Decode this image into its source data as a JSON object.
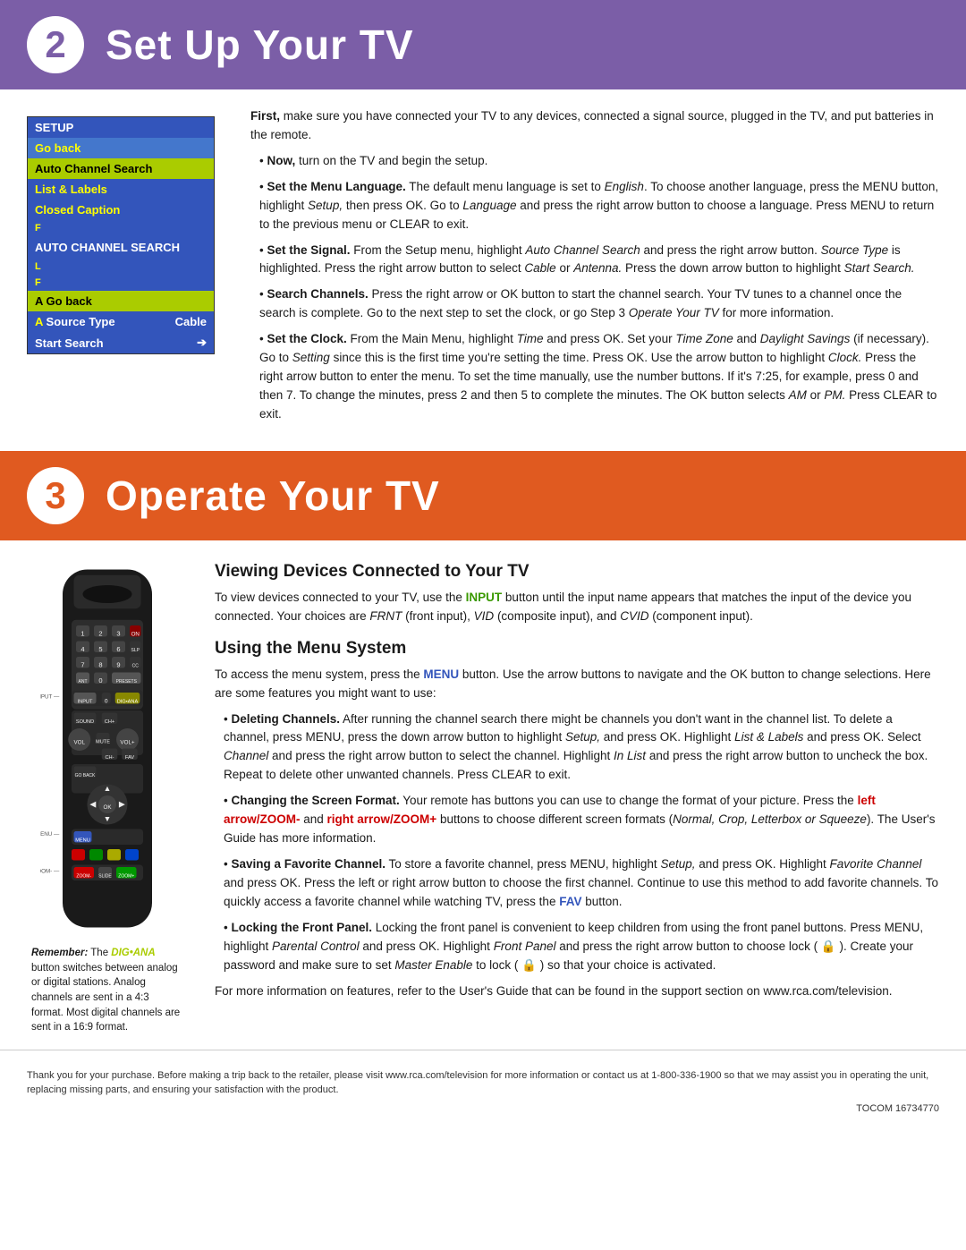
{
  "section2": {
    "number": "2",
    "title": "Set Up Your TV",
    "color": "#7b5ea7",
    "intro_para1": "First, make sure you have connected your TV to any devices, connected a signal source, plugged in the TV, and put batteries in the remote.",
    "bullets": [
      {
        "id": "now",
        "label": "Now,",
        "text": "turn on the TV and begin the setup."
      },
      {
        "id": "menu-language",
        "label": "Set the Menu Language.",
        "text": "The default menu language is set to English. To choose another language, press the MENU button, highlight Setup, then press OK. Go to Language and press the right arrow button to choose a language. Press MENU to return to the previous menu or CLEAR to exit."
      },
      {
        "id": "signal",
        "label": "Set the Signal.",
        "text": "From the Setup menu, highlight Auto Channel Search and press the right arrow button. Source Type is highlighted. Press the right arrow button to select Cable or Antenna. Press the down arrow button to highlight Start Search."
      },
      {
        "id": "search-channels",
        "label": "Search Channels.",
        "text": "Press the right arrow or OK button to start the channel search. Your TV tunes to a channel once the search is complete. Go to the next step to set the clock, or go Step 3 Operate Your TV for more information."
      },
      {
        "id": "clock",
        "label": "Set the Clock.",
        "text": "From the Main Menu, highlight Time and press OK. Set your Time Zone and Daylight Savings (if necessary). Go to Setting since this is the first time you're setting the time. Press OK. Use the arrow button to highlight Clock. Press the right arrow button to enter the menu. To set the time manually, use the number buttons. If it's 7:25, for example, press 0 and then 7. To change the minutes, press 2 and then 5 to complete the minutes. The OK button selects AM or PM. Press CLEAR to exit."
      }
    ],
    "menu": {
      "setup_label": "SETUP",
      "go_back": "Go back",
      "auto_channel_search": "Auto Channel Search",
      "list_labels": "List & Labels",
      "closed_caption": "Closed Caption",
      "auto_channel_highlight": "AUTO CHANNEL SEARCH",
      "go_back_2": "Go back",
      "source_type": "Source Type",
      "cable": "Cable",
      "start_search": "Start Search",
      "arrow": "➔"
    }
  },
  "section3": {
    "number": "3",
    "title": "Operate Your TV",
    "color": "#e05a20",
    "viewing_heading": "Viewing Devices Connected to Your TV",
    "viewing_text": "To view devices connected to your TV, use the INPUT button until the input name appears that matches the input of the device you connected. Your choices are FRNT (front input), VID (composite input), and CVID (component input).",
    "input_label": "INPUT",
    "menu_heading": "Using the Menu System",
    "menu_intro": "To access the menu system, press the MENU button. Use the arrow buttons to navigate and the OK button to change selections. Here are some features you might want to use:",
    "menu_label": "MENU",
    "bullets": [
      {
        "id": "deleting",
        "label": "Deleting Channels.",
        "text": "After running the channel search there might be channels you don't want in the channel list. To delete a channel, press MENU, press the down arrow button to highlight Setup, and press OK. Highlight List & Labels and press OK. Select Channel and press the right arrow button to select the channel. Highlight In List and press the right arrow button to uncheck the box. Repeat to delete other unwanted channels. Press CLEAR to exit."
      },
      {
        "id": "screen-format",
        "label": "Changing the Screen Format.",
        "text": "Your remote has buttons you can use to change the format of your picture. Press the left arrow/ZOOM- and right arrow/ZOOM+ buttons to choose different screen formats (Normal, Crop, Letterbox or Squeeze). The User's Guide has more information.",
        "left_zoom": "left arrow/ZOOM-",
        "right_zoom": "right arrow/ZOOM+"
      },
      {
        "id": "favorite",
        "label": "Saving a Favorite Channel.",
        "text": "To store a favorite channel, press MENU, highlight Setup, and press OK. Highlight Favorite Channel and press OK. Press the left or right arrow button to choose the first channel. Continue to use this method to add favorite channels. To quickly access a favorite channel while watching TV, press the FAV button.",
        "fav_label": "FAV"
      },
      {
        "id": "locking",
        "label": "Locking the Front Panel.",
        "text": "Locking the front panel is convenient to keep children from using the front panel buttons. Press MENU, highlight Parental Control and press OK. Highlight Front Panel and press the right arrow button to choose lock ( 🔒 ). Create your password and make sure to set Master Enable to lock ( 🔒 ) so that your choice is activated."
      }
    ],
    "closing_text": "For more information on features, refer to the User's Guide that can be found in the support section on www.rca.com/television.",
    "remote_note_bold": "Remember:",
    "remote_note_dig": "DIG•ANA",
    "remote_note_text": "button switches between analog or digital stations. Analog channels are sent in a 4:3 format. Most digital channels are sent in a 16:9 format.",
    "remote_labels": {
      "input": "INPUT",
      "menu": "MENU",
      "zoom": "ZOOM-"
    }
  },
  "footer": {
    "text": "Thank you for your purchase. Before making a trip back to the retailer, please visit www.rca.com/television for more information or contact us at 1-800-336-1900 so that we may assist you in operating the unit, replacing missing parts, and ensuring your satisfaction with the product.",
    "tocom": "TOCOM 16734770"
  }
}
